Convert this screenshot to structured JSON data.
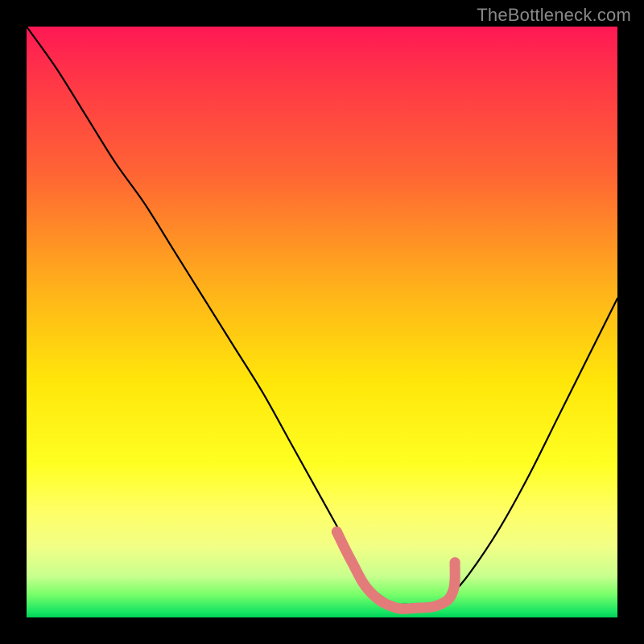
{
  "watermark": "TheBottleneck.com",
  "chart_data": {
    "type": "line",
    "title": "",
    "xlabel": "",
    "ylabel": "",
    "xlim": [
      0,
      100
    ],
    "ylim": [
      0,
      100
    ],
    "grid": false,
    "legend": false,
    "series": [
      {
        "name": "bottleneck-curve",
        "x": [
          0,
          5,
          10,
          15,
          20,
          25,
          30,
          35,
          40,
          45,
          50,
          55,
          58,
          62,
          66,
          70,
          72,
          75,
          80,
          85,
          90,
          95,
          100
        ],
        "y": [
          100,
          93,
          85,
          77,
          70,
          62,
          54,
          46,
          38,
          29,
          20,
          11,
          5.5,
          2.5,
          2.3,
          2.7,
          4.0,
          7.5,
          15,
          24,
          34,
          44,
          54
        ],
        "color": "#000000"
      },
      {
        "name": "highlight-band",
        "x": [
          52.5,
          55,
          58,
          62,
          66,
          70,
          72.2,
          72.5
        ],
        "y": [
          14.5,
          9.5,
          4.5,
          1.8,
          1.6,
          2.2,
          4.5,
          9.3
        ],
        "color": "#e47b7b"
      }
    ],
    "gradient_stops": [
      {
        "pos": 0,
        "color": "#ff1854"
      },
      {
        "pos": 8,
        "color": "#ff3348"
      },
      {
        "pos": 25,
        "color": "#ff6534"
      },
      {
        "pos": 45,
        "color": "#ffb419"
      },
      {
        "pos": 60,
        "color": "#ffe60a"
      },
      {
        "pos": 74,
        "color": "#ffff22"
      },
      {
        "pos": 82,
        "color": "#ffff66"
      },
      {
        "pos": 88,
        "color": "#f2ff86"
      },
      {
        "pos": 93,
        "color": "#c8ff8e"
      },
      {
        "pos": 96,
        "color": "#7cff6a"
      },
      {
        "pos": 99,
        "color": "#19e663"
      },
      {
        "pos": 100,
        "color": "#00d05a"
      }
    ]
  }
}
